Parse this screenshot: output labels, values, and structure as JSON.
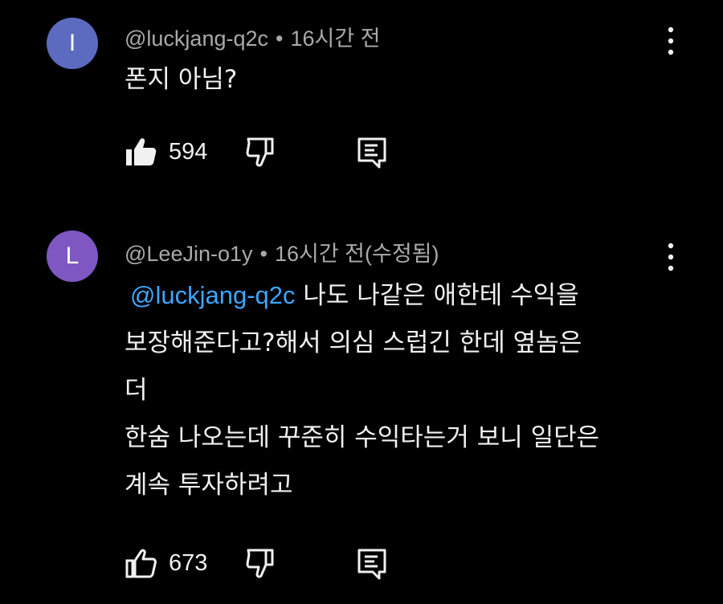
{
  "comments": [
    {
      "avatar_letter": "I",
      "avatar_color": "#5c6bc0",
      "handle": "@luckjang-q2c",
      "separator": "•",
      "time": "16시간 전",
      "text_lines": [
        "폰지 아님?"
      ],
      "likes": "594",
      "liked": true
    },
    {
      "avatar_letter": "L",
      "avatar_color": "#7e57c2",
      "handle": "@LeeJin-o1y",
      "separator": "•",
      "time": "16시간 전(수정됨)",
      "mention": "@luckjang-q2c",
      "text_lines": [
        "나도 나같은 애한테 수익을",
        "보장해준다고?해서 의심 스럽긴 한데 옆놈은",
        "더",
        "한숨 나오는데 꾸준히 수익타는거 보니 일단은",
        "계속 투자하려고"
      ],
      "likes": "673",
      "liked": false
    }
  ],
  "icons": {
    "like": "thumbs-up-icon",
    "dislike": "thumbs-down-icon",
    "reply": "reply-icon",
    "more": "more-vert-icon"
  },
  "colors": {
    "background": "#000000",
    "text": "#f1f1f1",
    "meta": "#aaaaaa",
    "mention": "#3ea6ff"
  }
}
